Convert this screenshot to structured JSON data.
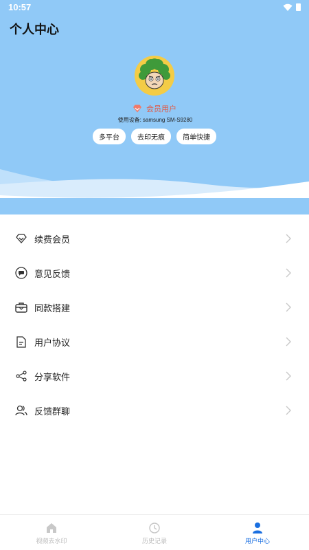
{
  "status_bar": {
    "time": "10:57"
  },
  "header": {
    "title": "个人中心",
    "member_label": "会员用户",
    "device_prefix": "使用设备:",
    "device_name": "samsung SM-S9280",
    "tags": [
      "多平台",
      "去印无痕",
      "简单快捷"
    ]
  },
  "colors": {
    "header_bg": "#90c9f7",
    "accent": "#1a6fe0",
    "member_red": "#e05a47",
    "avatar_bg": "#f4cc46"
  },
  "menu": [
    {
      "label": "续费会员",
      "icon": "diamond-icon"
    },
    {
      "label": "意见反馈",
      "icon": "chat-bubble-icon"
    },
    {
      "label": "同款搭建",
      "icon": "briefcase-icon"
    },
    {
      "label": "用户协议",
      "icon": "document-icon"
    },
    {
      "label": "分享软件",
      "icon": "share-icon"
    },
    {
      "label": "反馈群聊",
      "icon": "group-users-icon"
    }
  ],
  "bottom_nav": [
    {
      "label": "视频去水印",
      "icon": "home-icon",
      "active": false
    },
    {
      "label": "历史记录",
      "icon": "clock-icon",
      "active": false
    },
    {
      "label": "用户中心",
      "icon": "user-icon",
      "active": true
    }
  ]
}
